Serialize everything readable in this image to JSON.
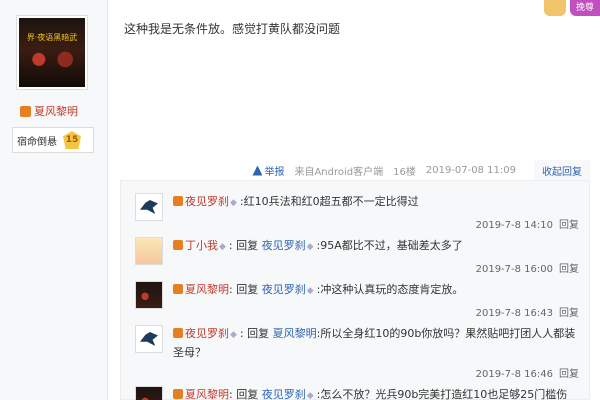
{
  "user": {
    "avatar_text": "界·夜语黑暗武",
    "name": "夏风黎明",
    "bar_title": "宿命倒悬",
    "level": "15"
  },
  "top_badge": {
    "label": "挽尊"
  },
  "post": {
    "text": "这种我是无条件放。感觉打黄队都没问题"
  },
  "tail": {
    "report": "举报",
    "source": "来自Android客户端",
    "floor": "16楼",
    "time": "2019-07-08 11:09",
    "fold": "收起回复"
  },
  "replies": [
    {
      "name": "夜见罗刹",
      "reply_label": "",
      "target": "",
      "content": "红10兵法和红0超五都不一定比得过",
      "time": "2019-7-8 14:10",
      "action": "回复"
    },
    {
      "name": "丁小我",
      "reply_label": "回复",
      "target": "夜见罗刹",
      "content": ":95A都比不过，基础差太多了",
      "time": "2019-7-8 16:00",
      "action": "回复"
    },
    {
      "name": "夏风黎明",
      "reply_label": "回复",
      "target": "夜见罗刹",
      "content": ":冲这种认真玩的态度肯定放。",
      "time": "2019-7-8 16:43",
      "action": "回复"
    },
    {
      "name": "夜见罗刹",
      "reply_label": "回复",
      "target": "夏风黎明",
      "content": ":所以全身红10的90b你放吗？果然贴吧打团人人都装圣母？",
      "time": "2019-7-8 16:46",
      "action": "回复"
    },
    {
      "name": "夏风黎明",
      "reply_label": "回复",
      "target": "夜见罗刹",
      "content": ":怎么不放？光兵90b完美打造红10也足够25门槛伤",
      "time": "",
      "action": ""
    }
  ]
}
